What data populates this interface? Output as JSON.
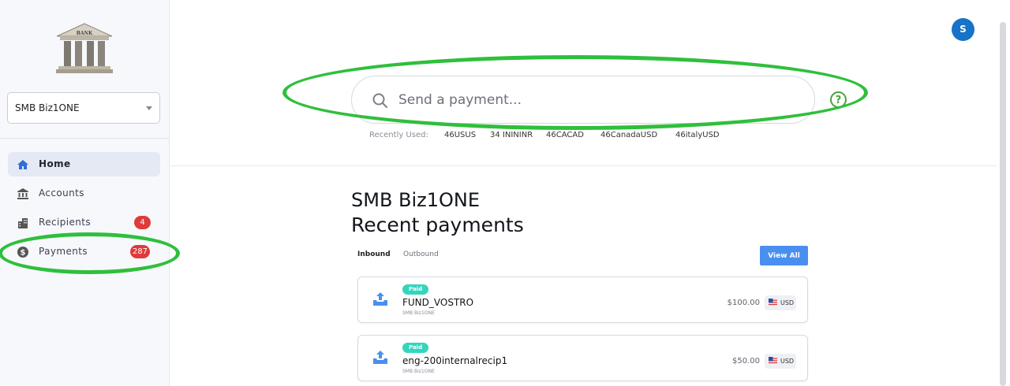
{
  "sidebar": {
    "logo_text": "BANK",
    "org_select": {
      "value": "SMB Biz1ONE"
    },
    "nav": [
      {
        "label": "Home",
        "icon": "home-icon",
        "active": true
      },
      {
        "label": "Accounts",
        "icon": "bank-icon"
      },
      {
        "label": "Recipients",
        "icon": "building-icon",
        "count": "4"
      },
      {
        "label": "Payments",
        "icon": "dollar-circle-icon",
        "count": "287"
      }
    ]
  },
  "header": {
    "avatar_initial": "S"
  },
  "search": {
    "placeholder": "Send a payment...",
    "recently_used_label": "Recently Used:",
    "recent_items": [
      "46USUS",
      "34 INININR",
      "46CACAD",
      "46CanadaUSD",
      "46italyUSD"
    ]
  },
  "main": {
    "org_title": "SMB Biz1ONE",
    "section_title": "Recent payments",
    "tabs": [
      {
        "label": "Inbound",
        "active": true
      },
      {
        "label": "Outbound"
      }
    ],
    "view_all_label": "View All",
    "payments": [
      {
        "status": "Paid",
        "name": "FUND_VOSTRO",
        "org": "SMB Biz1ONE",
        "amount": "$100.00",
        "currency": "USD"
      },
      {
        "status": "Paid",
        "name": "eng-200internalrecip1",
        "org": "SMB Biz1ONE",
        "amount": "$50.00",
        "currency": "USD"
      }
    ]
  },
  "colors": {
    "accent": "#4a8ff0",
    "avatar": "#1673c7",
    "badge": "#e03a3a",
    "status_paid": "#33d6bd",
    "highlight": "#2fbf3c"
  }
}
